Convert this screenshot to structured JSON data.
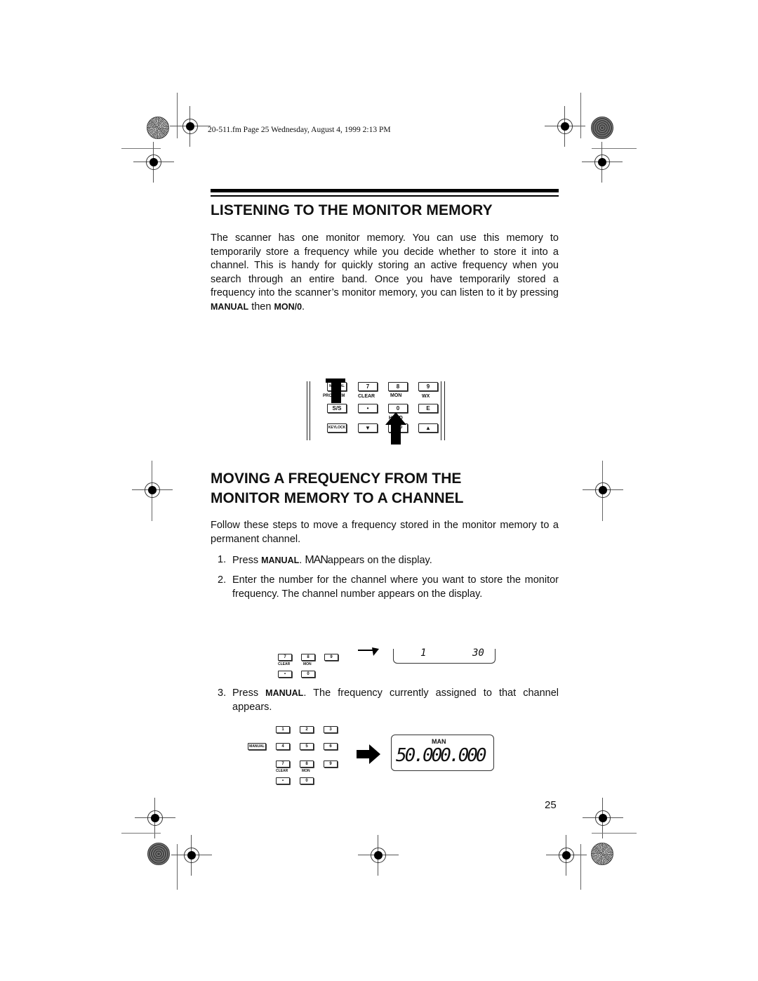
{
  "header": {
    "file_info": "20-511.fm  Page 25  Wednesday, August 4, 1999  2:13 PM"
  },
  "section1": {
    "title": "LISTENING TO THE MONITOR MEMORY",
    "body_pre": "The scanner has one monitor memory. You can use this memory to temporarily store a frequency while you decide whether to store it into a channel. This is handy for quickly storing an active frequency when you search through an entire band. Once you have temporarily stored a frequency into the scanner’s monitor memory, you can listen to it by pressing ",
    "key1": "MANUAL",
    "mid": " then ",
    "key2": "MON/0",
    "end": "."
  },
  "keypad1": {
    "keys": [
      "MANUAL",
      "7",
      "8",
      "9",
      "S/S",
      "•",
      "0",
      "E",
      "KEYLOCK",
      "▼",
      "RSD",
      "▲"
    ],
    "labels": [
      "PROGRAM",
      "CLEAR",
      "MON",
      "WX",
      "HOLD"
    ]
  },
  "section2": {
    "title_line1": "MOVING A FREQUENCY FROM THE",
    "title_line2": "MONITOR MEMORY TO A CHANNEL",
    "intro": "Follow these steps to move a frequency stored in the monitor memory to a permanent channel.",
    "steps": [
      {
        "num": "1.",
        "pre": "Press ",
        "key": "MANUAL",
        "mid": ". ",
        "lcd": "MAN",
        "post": "appears on the display."
      },
      {
        "num": "2.",
        "text": "Enter the number for the channel where you want to store the monitor frequency. The channel number appears on the display."
      },
      {
        "num": "3.",
        "pre": "Press ",
        "key": "MANUAL",
        "post": ". The frequency currently assigned to that channel appears."
      }
    ]
  },
  "figure2": {
    "keys": [
      "7",
      "8",
      "9",
      "•",
      "0"
    ],
    "labels": [
      "CLEAR",
      "MON"
    ],
    "display_left": "1",
    "display_right": "30"
  },
  "figure3": {
    "keys": [
      "1",
      "2",
      "3",
      "MANUAL",
      "4",
      "5",
      "6",
      "7",
      "8",
      "9",
      "•",
      "0"
    ],
    "labels": [
      "CLEAR",
      "MON"
    ],
    "display_mode": "MAN",
    "display_freq": "50.000.000"
  },
  "footer": {
    "page_number": "25"
  }
}
